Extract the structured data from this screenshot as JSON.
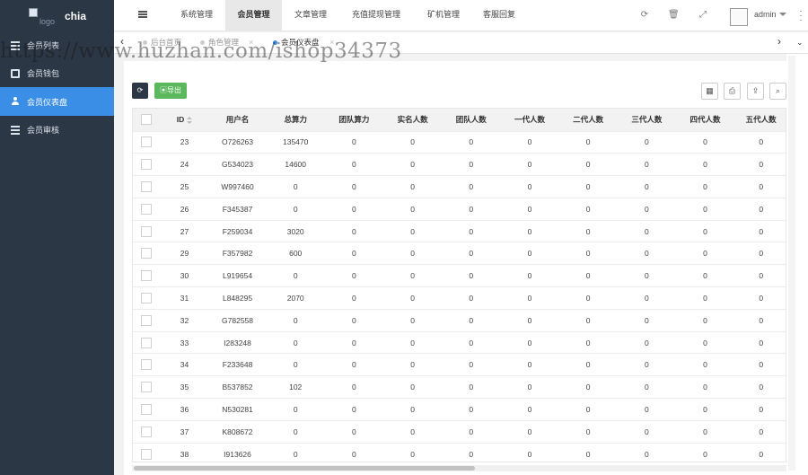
{
  "app": {
    "logo_alt": "logo",
    "brand": "chia"
  },
  "sidebar": {
    "items": [
      {
        "label": "会员列表",
        "icon": "list-icon",
        "active": false
      },
      {
        "label": "会员钱包",
        "icon": "wallet-icon",
        "active": false
      },
      {
        "label": "会员仪表盘",
        "icon": "person-icon",
        "active": true
      },
      {
        "label": "会员审核",
        "icon": "list-icon",
        "active": false
      }
    ]
  },
  "topnav": {
    "items": [
      "系统管理",
      "会员管理",
      "文章管理",
      "充值提现管理",
      "矿机管理",
      "客服回复"
    ],
    "active_index": 1,
    "user": "admin"
  },
  "tabs": {
    "items": [
      {
        "label": "后台首页",
        "active": false,
        "closable": false
      },
      {
        "label": "角色管理",
        "active": false,
        "closable": true
      },
      {
        "label": "会员仪表盘",
        "active": true,
        "closable": true
      }
    ]
  },
  "watermark": "https://www.huzhan.com/ishop34373",
  "toolbar": {
    "export_label": "导出"
  },
  "table": {
    "columns": [
      "",
      "ID",
      "用户名",
      "总算力",
      "团队算力",
      "实名人数",
      "团队人数",
      "一代人数",
      "二代人数",
      "三代人数",
      "四代人数",
      "五代人数"
    ],
    "rows": [
      [
        "23",
        "O726263",
        "135470",
        "0",
        "0",
        "0",
        "0",
        "0",
        "0",
        "0",
        "0"
      ],
      [
        "24",
        "G534023",
        "14600",
        "0",
        "0",
        "0",
        "0",
        "0",
        "0",
        "0",
        "0"
      ],
      [
        "25",
        "W997460",
        "0",
        "0",
        "0",
        "0",
        "0",
        "0",
        "0",
        "0",
        "0"
      ],
      [
        "26",
        "F345387",
        "0",
        "0",
        "0",
        "0",
        "0",
        "0",
        "0",
        "0",
        "0"
      ],
      [
        "27",
        "F259034",
        "3020",
        "0",
        "0",
        "0",
        "0",
        "0",
        "0",
        "0",
        "0"
      ],
      [
        "29",
        "F357982",
        "600",
        "0",
        "0",
        "0",
        "0",
        "0",
        "0",
        "0",
        "0"
      ],
      [
        "30",
        "L919654",
        "0",
        "0",
        "0",
        "0",
        "0",
        "0",
        "0",
        "0",
        "0"
      ],
      [
        "31",
        "L848295",
        "2070",
        "0",
        "0",
        "0",
        "0",
        "0",
        "0",
        "0",
        "0"
      ],
      [
        "32",
        "G782558",
        "0",
        "0",
        "0",
        "0",
        "0",
        "0",
        "0",
        "0",
        "0"
      ],
      [
        "33",
        "I283248",
        "0",
        "0",
        "0",
        "0",
        "0",
        "0",
        "0",
        "0",
        "0"
      ],
      [
        "34",
        "F233648",
        "0",
        "0",
        "0",
        "0",
        "0",
        "0",
        "0",
        "0",
        "0"
      ],
      [
        "35",
        "B537852",
        "102",
        "0",
        "0",
        "0",
        "0",
        "0",
        "0",
        "0",
        "0"
      ],
      [
        "36",
        "N530281",
        "0",
        "0",
        "0",
        "0",
        "0",
        "0",
        "0",
        "0",
        "0"
      ],
      [
        "37",
        "K808672",
        "0",
        "0",
        "0",
        "0",
        "0",
        "0",
        "0",
        "0",
        "0"
      ],
      [
        "38",
        "I913626",
        "0",
        "0",
        "0",
        "0",
        "0",
        "0",
        "0",
        "0",
        "0"
      ]
    ]
  },
  "colors": {
    "sidebar": "#2c3746",
    "active": "#3a8ee6",
    "export": "#5cb85c"
  }
}
